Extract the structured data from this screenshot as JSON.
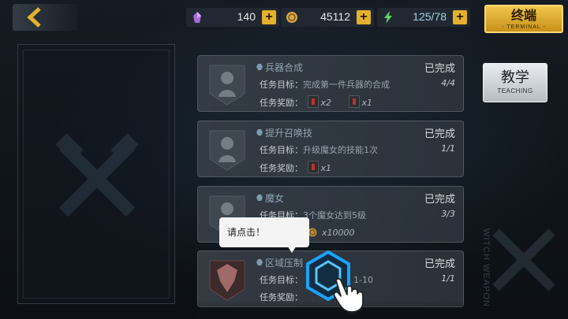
{
  "currencies": [
    {
      "name": "crystal",
      "icon": "crystal-icon",
      "value": "140",
      "color": "#a56bd9"
    },
    {
      "name": "gold",
      "icon": "coin-icon",
      "value": "45112",
      "color": "#d8a84a"
    },
    {
      "name": "energy",
      "icon": "lightning-icon",
      "value": "125/78",
      "color": "#5fd46a"
    }
  ],
  "plus_label": "+",
  "terminal": {
    "main": "终端",
    "sub": "- TERMINAL -"
  },
  "teaching": {
    "main": "教学",
    "sub": "TEACHING"
  },
  "side_text": "WITCH WEAPON",
  "label_goal": "任务目标：",
  "label_reward": "任务奖励：",
  "missions": [
    {
      "title": "兵器合成",
      "status": "已完成",
      "goal": "完成第一件兵器的合成",
      "progress": "4/4",
      "rewards": [
        {
          "qty": "x2"
        },
        {
          "qty": "x1"
        }
      ]
    },
    {
      "title": "提升召唤技",
      "status": "已完成",
      "goal": "升级魔女的技能1次",
      "progress": "1/1",
      "rewards": [
        {
          "qty": "x1"
        }
      ]
    },
    {
      "title": "魔女",
      "status": "已完成",
      "goal": "3个魔女达到5级",
      "progress": "3/3",
      "rewards": [
        {
          "qty": "x10000"
        }
      ]
    },
    {
      "title": "区域压制",
      "status": "已完成",
      "goal": "1-10",
      "progress": "1/1",
      "rewards": []
    }
  ],
  "tooltip": "请点击！",
  "colors": {
    "accent": "#e3b12c",
    "highlight": "#1aa3ff"
  }
}
